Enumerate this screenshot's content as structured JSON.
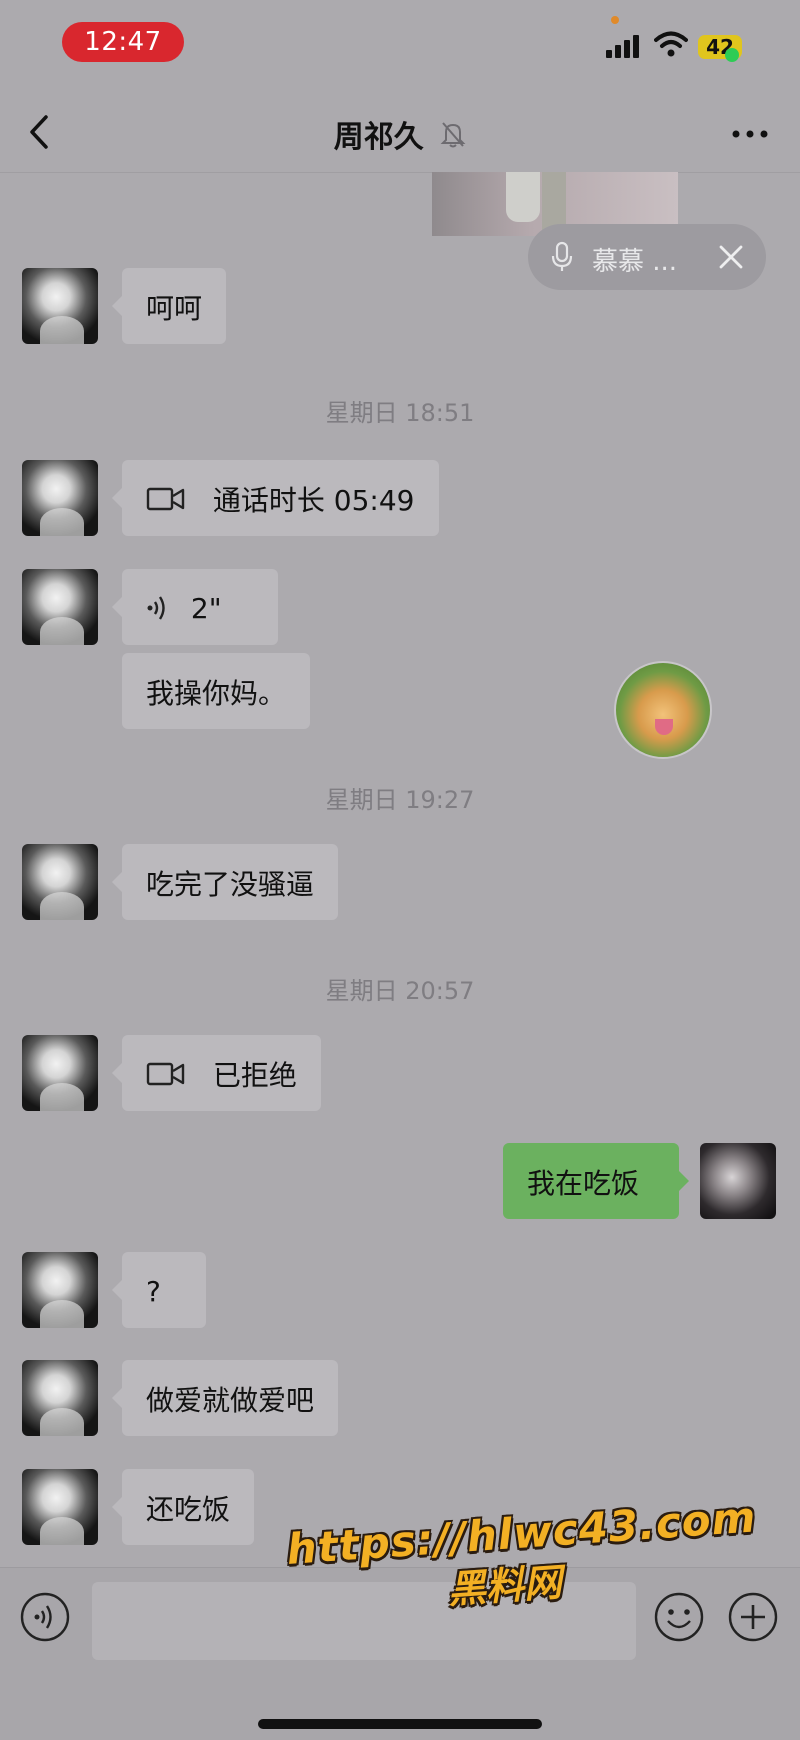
{
  "status_bar": {
    "time": "12:47",
    "battery": "42"
  },
  "header": {
    "title": "周祁久"
  },
  "floating_voice": {
    "name": "慕慕 ..."
  },
  "messages": [
    {
      "text": "呵呵"
    },
    {
      "timestamp": "星期日 18:51"
    },
    {
      "text": "通话时长 05:49",
      "icon": "video-call-icon"
    },
    {
      "text": "2\"",
      "icon": "voice-wave-icon"
    },
    {
      "text": "我操你妈。"
    },
    {
      "timestamp": "星期日 19:27"
    },
    {
      "text": "吃完了没骚逼"
    },
    {
      "timestamp": "星期日 20:57"
    },
    {
      "text": "已拒绝",
      "icon": "video-call-icon"
    },
    {
      "text": "我在吃饭",
      "from": "me"
    },
    {
      "text": "?"
    },
    {
      "text": "做爱就做爱吧"
    },
    {
      "text": "还吃饭"
    }
  ],
  "watermark": {
    "url": "https://hlwc43.com",
    "site": "黑料网"
  },
  "colors": {
    "background": "#acaaae",
    "bubble_in": "#bbb9bd",
    "bubble_out": "#6bb15f",
    "time_pill": "#d9272e"
  }
}
